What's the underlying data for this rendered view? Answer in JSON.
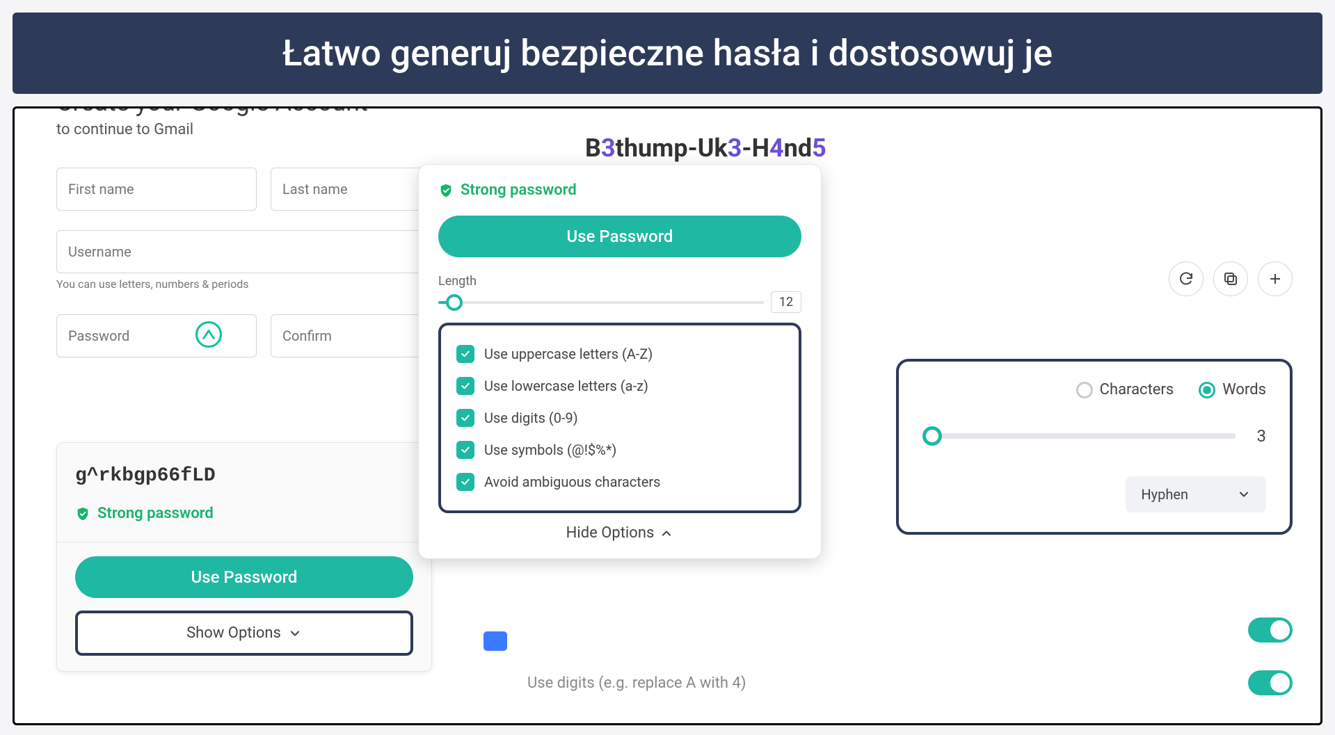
{
  "banner": "Łatwo generuj bezpieczne hasła i dostosowuj je",
  "google": {
    "title": "Create your Google Account",
    "subtitle": "to continue to Gmail",
    "first_name_ph": "First name",
    "last_name_ph": "Last name",
    "username_ph": "Username",
    "at": "@",
    "hint": "You can use letters, numbers & periods",
    "password_ph": "Password",
    "confirm_ph": "Confirm"
  },
  "popup_small": {
    "generated": "g^rkbgp66fLD",
    "strong": "Strong password",
    "use_btn": "Use Password",
    "show_options": "Show Options"
  },
  "popup_big": {
    "strong": "Strong password",
    "use_btn": "Use Password",
    "length_label": "Length",
    "length_value": "12",
    "opts": [
      "Use uppercase letters (A-Z)",
      "Use lowercase letters (a-z)",
      "Use digits (0-9)",
      "Use symbols (@!$%*)",
      "Avoid ambiguous characters"
    ],
    "hide_options": "Hide Options"
  },
  "right": {
    "password_parts": [
      "B",
      "3",
      "thump-Uk",
      "3",
      "-H",
      "4",
      "nd",
      "5"
    ],
    "radio_characters": "Characters",
    "radio_words": "Words",
    "word_count": "3",
    "separator": "Hyphen",
    "digits_label": "Use digits (e.g. replace A with 4)"
  }
}
